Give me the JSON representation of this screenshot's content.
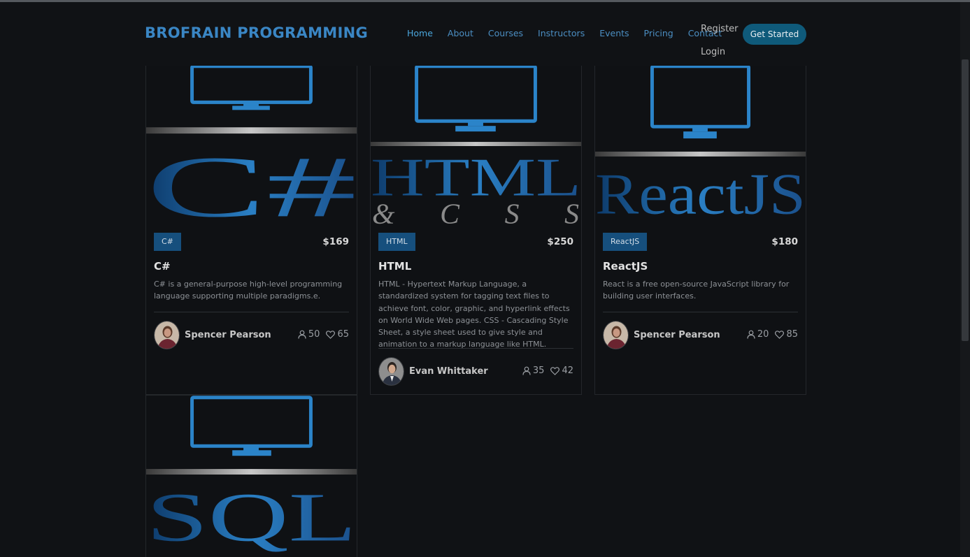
{
  "brand": "BROFRAIN PROGRAMMING",
  "nav": [
    "Home",
    "About",
    "Courses",
    "Instructors",
    "Events",
    "Pricing",
    "Contact"
  ],
  "auth": {
    "register": "Register",
    "login": "Login"
  },
  "cta": "Get Started",
  "colors": {
    "accent": "#3a86c4",
    "tag": "#164f7d",
    "button": "#0f5a7a",
    "background": "#101215"
  },
  "courses": [
    {
      "tag": "C#",
      "price": "$169",
      "title": "C#",
      "description": "C# is a general-purpose high-level programming language supporting multiple paradigms.e.",
      "instructor": "Spencer Pearson",
      "students": "50",
      "likes": "65",
      "thumb_text": "C#"
    },
    {
      "tag": "HTML",
      "price": "$250",
      "title": "HTML",
      "description": "HTML - Hypertext Markup Language, a standardized system for tagging text files to achieve font, color, graphic, and hyperlink effects on World Wide Web pages. CSS - Cascading Style Sheet, a style sheet used to give style and animation to a markup language like HTML.",
      "instructor": "Evan Whittaker",
      "students": "35",
      "likes": "42",
      "thumb_text": "HTML",
      "thumb_sub": "& C S S"
    },
    {
      "tag": "ReactJS",
      "price": "$180",
      "title": "ReactJS",
      "description": "React is a free open-source JavaScript library for building user interfaces.",
      "instructor": "Spencer Pearson",
      "students": "20",
      "likes": "85",
      "thumb_text": "ReactJS"
    },
    {
      "thumb_text": "SQL"
    }
  ],
  "icons": {
    "students": "user-icon",
    "likes": "heart-icon",
    "thumbnail": "monitor-icon"
  }
}
